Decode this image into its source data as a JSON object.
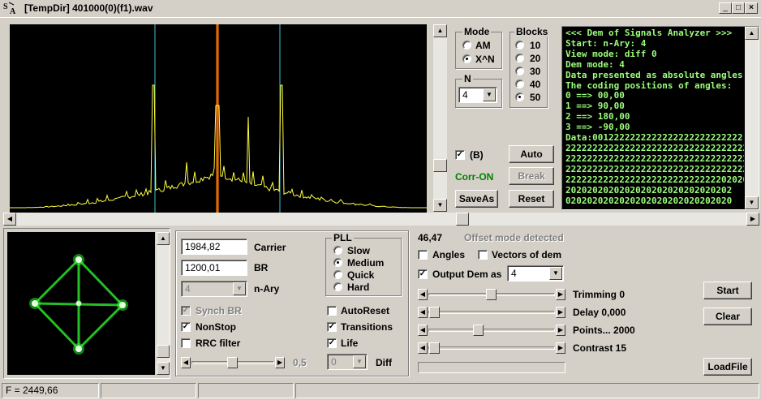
{
  "window": {
    "title": "[TempDir] 401000(0)(f1).wav",
    "logo_text": "S A",
    "minimize": "_",
    "maximize": "□",
    "close": "×"
  },
  "mode": {
    "legend": "Mode",
    "options": [
      "AM",
      "X^N"
    ],
    "selected": "X^N"
  },
  "n_group": {
    "legend": "N",
    "value": "4"
  },
  "blocks": {
    "legend": "Blocks",
    "options": [
      "10",
      "20",
      "30",
      "40",
      "50"
    ],
    "selected": "50"
  },
  "b_check": {
    "label": "(B)",
    "checked": true
  },
  "corr_status": {
    "text": "Corr-ON",
    "color": "#008000"
  },
  "buttons": {
    "auto": "Auto",
    "break": "Break",
    "saveas": "SaveAs",
    "reset": "Reset",
    "start": "Start",
    "clear": "Clear",
    "loadfile": "LoadFile"
  },
  "console_lines": [
    "<<< Dem of Signals Analyzer >>>",
    "Start: n-Ary: 4",
    "View mode: diff 0",
    "Dem mode: 4",
    "Data presented as absolute angles!",
    "The coding positions of angles:",
    "0 ==> 00,00",
    "1 ==> 90,00",
    "2 ==> 180,00",
    "3 ==> -90,00",
    "Data:0012222222222222222222222222",
    "2222222222222222222222222222222222",
    "2222222222222222222222222222222222",
    "2222222222222222222222222222222222",
    "2222222222222222222222222222202020",
    "2020202020202020202020202020202",
    "0202020202020202020202020202020"
  ],
  "params": {
    "carrier_value": "1984,82",
    "carrier_label": "Carrier",
    "br_value": "1200,01",
    "br_label": "BR",
    "nary_value": "4",
    "nary_label": "n-Ary",
    "synch_br": "Synch BR",
    "nonstop": "NonStop",
    "rrc": "RRC filter",
    "slider_value": "0,5",
    "diff_value": "0",
    "diff_label": "Diff"
  },
  "pll": {
    "legend": "PLL",
    "options": [
      "Slow",
      "Medium",
      "Quick",
      "Hard"
    ],
    "selected": "Medium"
  },
  "checks_right": {
    "autoreset": "AutoReset",
    "transitions": "Transitions",
    "life": "Life"
  },
  "offset": {
    "value": "46,47",
    "status": "Offset mode detected"
  },
  "display_opts": {
    "angles": "Angles",
    "vectors": "Vectors of dem",
    "output_dem": "Output Dem as",
    "output_value": "4"
  },
  "sliders": {
    "trimming": "Trimming 0",
    "delay": "Delay  0,000",
    "points": "Points... 2000",
    "contrast": "Contrast 15"
  },
  "statusbar": {
    "freq": "F = 2449,66"
  },
  "colors": {
    "spectrum_trace": "#ffff40",
    "marker_cyan": "#40c0d0",
    "marker_red": "#ff2020",
    "marker_orange": "#ff9000",
    "constellation": "#30ff30",
    "console_text": "#9cff7c"
  }
}
